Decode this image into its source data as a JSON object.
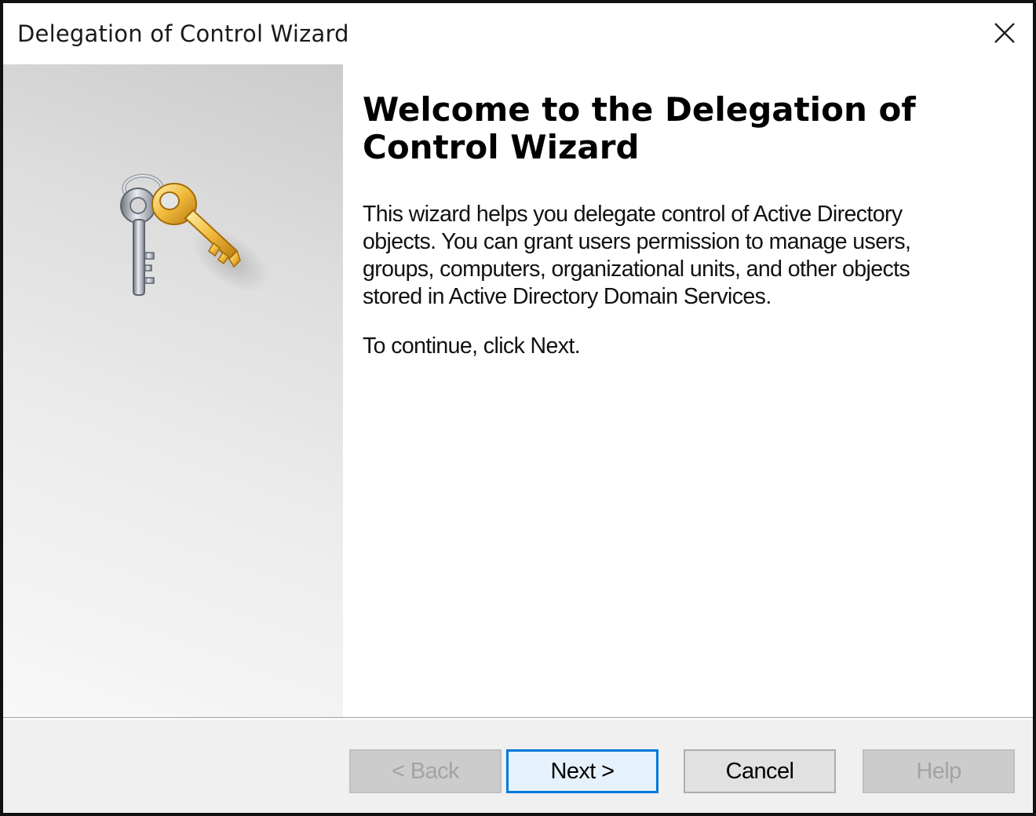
{
  "window": {
    "title": "Delegation of Control Wizard"
  },
  "content": {
    "heading": "Welcome to the Delegation of Control Wizard",
    "description": "This wizard helps you delegate control of Active Directory objects. You can grant users permission to manage users, groups, computers, organizational units, and other objects stored in Active Directory Domain Services.",
    "instruction": "To continue, click Next."
  },
  "buttons": {
    "back": "< Back",
    "next": "Next >",
    "cancel": "Cancel",
    "help": "Help"
  },
  "icons": {
    "close": "close-icon",
    "keys": "keys-icon"
  },
  "colors": {
    "default_button_border": "#0078d7",
    "disabled_text": "#a3a3a3"
  }
}
